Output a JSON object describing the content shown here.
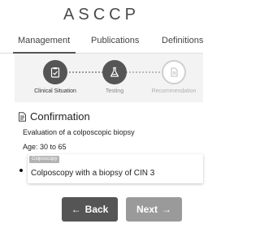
{
  "header": {
    "logo_text": "ASCCP"
  },
  "tabs": [
    {
      "label": "Management",
      "active": true
    },
    {
      "label": "Publications",
      "active": false
    },
    {
      "label": "Definitions",
      "active": false
    }
  ],
  "stepper": {
    "steps": [
      {
        "label": "Clinical Situation",
        "icon": "clipboard-check-icon",
        "state": "complete"
      },
      {
        "label": "Testing",
        "icon": "flask-icon",
        "state": "current"
      },
      {
        "label": "Recommendation",
        "icon": "document-icon",
        "state": "upcoming"
      }
    ]
  },
  "section": {
    "icon": "document-icon",
    "title": "Confirmation",
    "description": "Evaluation of a colposcopic biopsy",
    "age": "Age: 30 to 65"
  },
  "option": {
    "tag": "Colposcopy",
    "text": "Colposcopy with a biopsy of CIN 3"
  },
  "nav": {
    "back_label": "Back",
    "next_label": "Next",
    "back_icon": "arrow-left-icon",
    "next_icon": "arrow-right-icon"
  },
  "colors": {
    "primary_dark": "#555555",
    "disabled_gray": "#9a9a9a",
    "stepper_bg": "#f3f3f3"
  }
}
